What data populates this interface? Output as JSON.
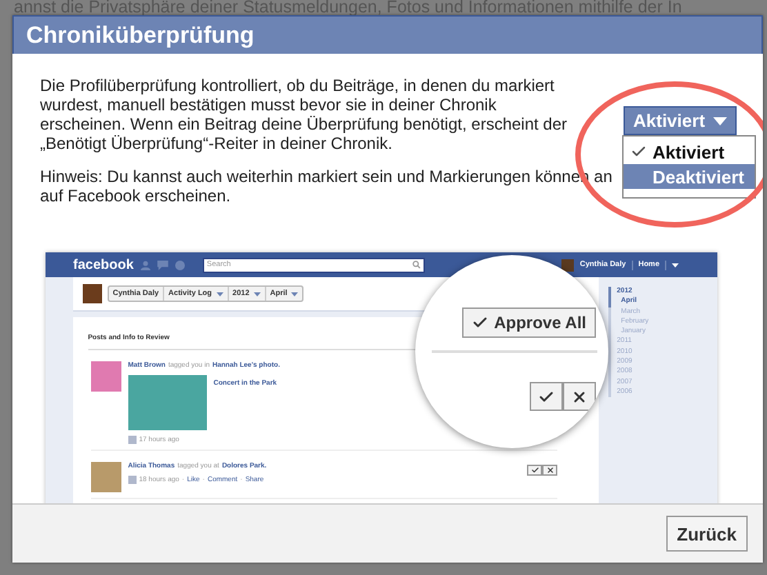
{
  "backdrop_text": "annst die Privatsphäre deiner Statusmeldungen, Fotos und Informationen mithilfe der In",
  "dialog": {
    "title": "Chroniküberprüfung",
    "paragraphs": [
      "Die Profilüberprüfung kontrolliert, ob du Beiträge, in denen du markiert wurdest, manuell bestätigen musst bevor sie in deiner Chronik erscheinen. Wenn ein Beitrag deine Überprüfung benötigt, erscheint der „Benötigt Überprüfung“-Reiter in deiner Chronik.",
      "Hinweis: Du kannst auch weiterhin markiert sein und Markierungen können an auf Facebook erscheinen."
    ],
    "toggle": {
      "label": "Aktiviert",
      "expanded": true
    },
    "menu": [
      {
        "label": "Aktiviert",
        "checked": true,
        "hovered": false
      },
      {
        "label": "Deaktiviert",
        "checked": false,
        "hovered": true
      }
    ],
    "preview": {
      "brand": "facebook",
      "search": {
        "placeholder": "Search"
      },
      "account": {
        "name": "Cynthia Daly",
        "nav": "Home"
      },
      "profile_bar": [
        {
          "label": "Cynthia Daly",
          "dropdown": false
        },
        {
          "label": "Activity Log",
          "dropdown": true
        },
        {
          "label": "2012",
          "dropdown": true
        },
        {
          "label": "April",
          "dropdown": true
        }
      ],
      "section_title": "Posts and Info to Review",
      "posts": [
        {
          "author": "Matt Brown",
          "action": "tagged you in",
          "target": "Hannah Lee's photo.",
          "attachment": "Concert in the Park",
          "meta": [
            {
              "kind": "time",
              "text": "17 hours ago"
            }
          ]
        },
        {
          "author": "Alicia Thomas",
          "action": "tagged you at",
          "target": "Dolores Park.",
          "meta": [
            {
              "kind": "time",
              "text": "18 hours ago"
            },
            {
              "kind": "sep",
              "text": "·"
            },
            {
              "kind": "link",
              "text": "Like"
            },
            {
              "kind": "sep",
              "text": "·"
            },
            {
              "kind": "link",
              "text": "Comment"
            },
            {
              "kind": "sep",
              "text": "·"
            },
            {
              "kind": "link",
              "text": "Share"
            }
          ]
        }
      ],
      "magnifier": {
        "approve_all": "Approve All"
      },
      "timeline": [
        {
          "label": "2012",
          "kind": "year",
          "selected": true
        },
        {
          "label": "April",
          "kind": "month",
          "selected": true
        },
        {
          "label": "March",
          "kind": "month",
          "selected": false
        },
        {
          "label": "February",
          "kind": "month",
          "selected": false
        },
        {
          "label": "January",
          "kind": "month",
          "selected": false
        },
        {
          "label": "2011",
          "kind": "year",
          "selected": false
        },
        {
          "label": "2010",
          "kind": "year",
          "selected": false
        },
        {
          "label": "2009",
          "kind": "year",
          "selected": false
        },
        {
          "label": "2008",
          "kind": "year",
          "selected": false
        },
        {
          "label": "2007",
          "kind": "year",
          "selected": false
        },
        {
          "label": "2006",
          "kind": "year",
          "selected": false
        }
      ]
    },
    "buttons": [
      "Zurück"
    ]
  }
}
